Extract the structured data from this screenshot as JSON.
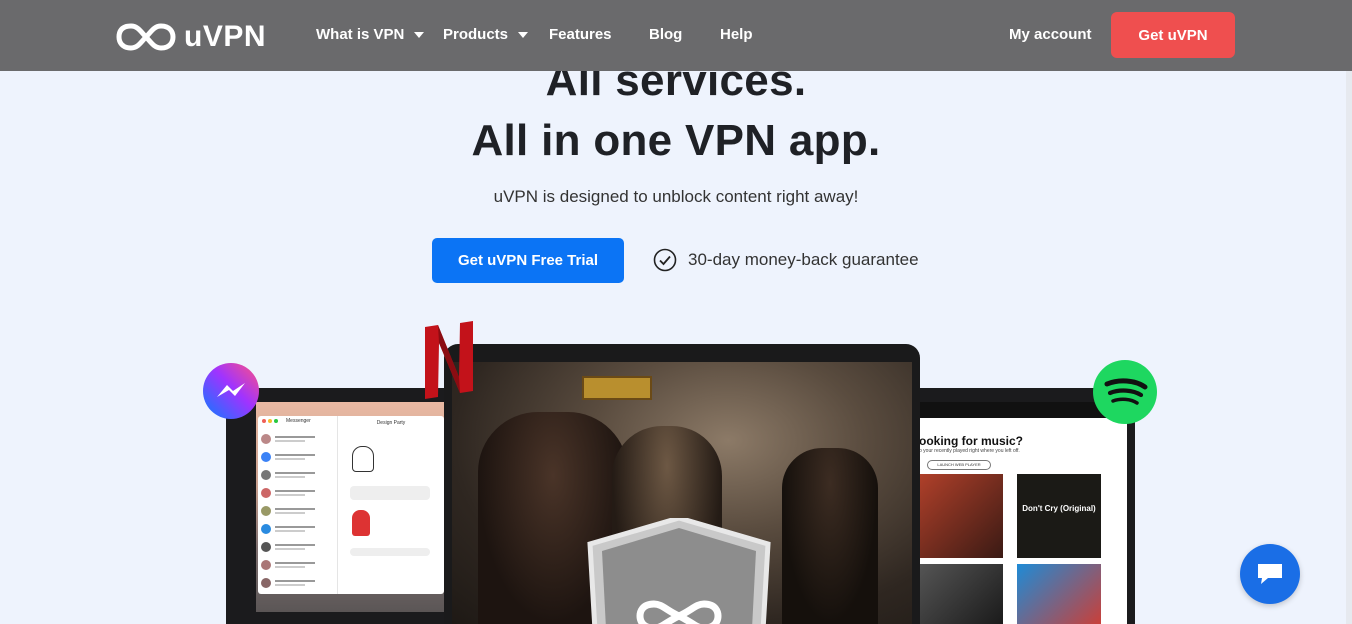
{
  "nav": {
    "logo_text": "uVPN",
    "items": [
      {
        "label": "What is VPN",
        "dropdown": true
      },
      {
        "label": "Products",
        "dropdown": true
      },
      {
        "label": "Features",
        "dropdown": false
      },
      {
        "label": "Blog",
        "dropdown": false
      },
      {
        "label": "Help",
        "dropdown": false
      }
    ],
    "my_account": "My account",
    "cta": "Get uVPN"
  },
  "hero": {
    "title_line1": "All services.",
    "title_line2": "All in one VPN app.",
    "subtitle": "uVPN is designed to unblock content right away!",
    "trial_button": "Get uVPN Free Trial",
    "guarantee": "30-day money-back guarantee"
  },
  "devices": {
    "messenger_window_title": "Messenger",
    "messenger_conversation_title": "Design Party",
    "spotify_heading": "ooking for music?",
    "spotify_sub": "p your recently played right where you left off.",
    "spotify_button": "LAUNCH WEB PLAYER",
    "album_tile_title": "Don't Cry (Original)"
  },
  "icons": [
    "logo-infinity-icon",
    "caret-down-icon",
    "check-circle-icon",
    "netflix-icon",
    "messenger-icon",
    "spotify-icon",
    "shield-logo-icon",
    "chat-icon"
  ],
  "colors": {
    "nav_bg": "#6a6a6c",
    "cta_red": "#ef4f4f",
    "primary_blue": "#0b74f5",
    "page_bg": "#eef3fd",
    "spotify_green": "#1ed760",
    "netflix_red": "#c3121a"
  }
}
